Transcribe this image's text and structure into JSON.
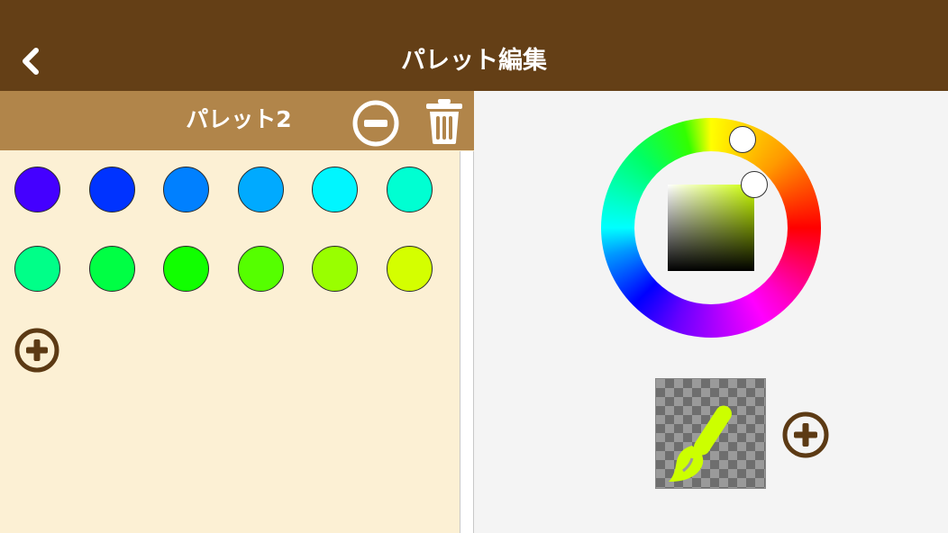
{
  "header": {
    "title": "パレット編集",
    "back_icon": "chevron-left-icon"
  },
  "palette": {
    "name": "パレット2",
    "remove_icon": "minus-circle-icon",
    "delete_icon": "trash-icon",
    "add_icon": "plus-circle-icon",
    "swatches": [
      {
        "color": "#4400ff"
      },
      {
        "color": "#0033ff"
      },
      {
        "color": "#0080ff"
      },
      {
        "color": "#00aaff"
      },
      {
        "color": "#00f6ff"
      },
      {
        "color": "#00ffd2"
      },
      {
        "color": "#00ff88"
      },
      {
        "color": "#00ff44"
      },
      {
        "color": "#11ff00"
      },
      {
        "color": "#55ff00"
      },
      {
        "color": "#99ff00"
      },
      {
        "color": "#d4ff00"
      }
    ]
  },
  "picker": {
    "current_color": "#ccff00",
    "preview_icon": "paintbrush-icon",
    "add_icon": "plus-circle-icon"
  },
  "colors": {
    "header_bg": "#643f16",
    "palette_header_bg": "#b1854a",
    "panel_bg": "#fcf0d4",
    "accent": "#5c3a14"
  }
}
